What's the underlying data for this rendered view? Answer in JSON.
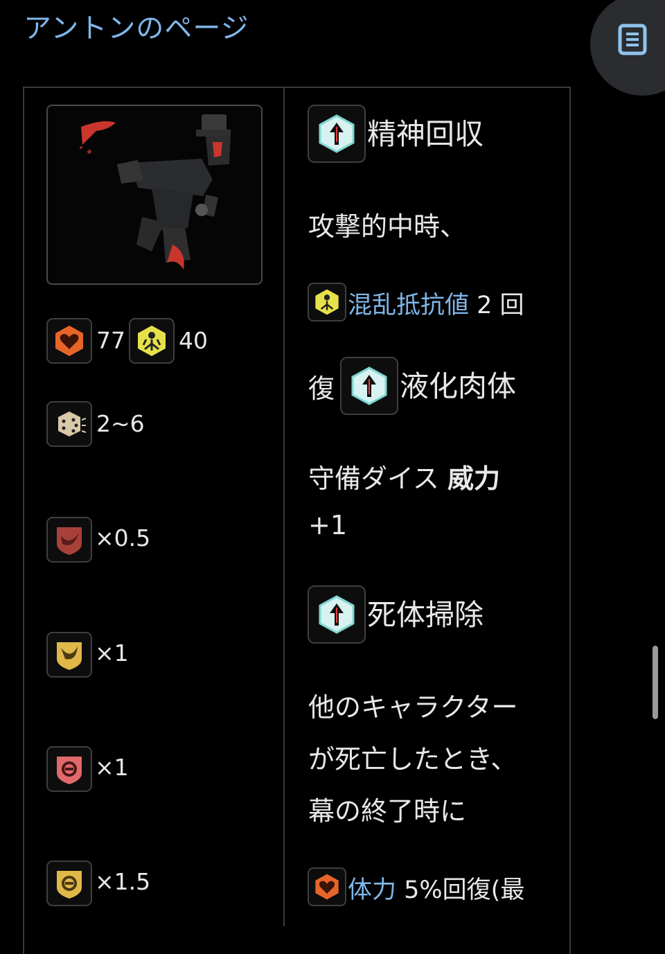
{
  "header": {
    "title": "アントンのページ"
  },
  "menu": {
    "icon": "list-document-icon"
  },
  "left": {
    "portrait_alt": "character-portrait",
    "stats": [
      {
        "icon": "health-heart-icon",
        "value": "77",
        "color": "#e8652a"
      },
      {
        "icon": "stress-resist-icon",
        "value": "40",
        "color": "#e6e14a"
      }
    ],
    "dice": {
      "icon": "dice-icon",
      "value": "2~6"
    },
    "resistances": [
      {
        "icon": "slash-resist-icon",
        "value": "×0.5",
        "color": "#a8413a"
      },
      {
        "icon": "pierce-resist-icon",
        "value": "×1",
        "color": "#e0b84a"
      },
      {
        "icon": "blunt-resist-icon",
        "value": "×1",
        "color": "#e06a6a"
      },
      {
        "icon": "stagger-resist-icon",
        "value": "×1.5",
        "color": "#e0b84a"
      }
    ]
  },
  "right": {
    "skill1": {
      "name": "精神回収",
      "icon": "passive-arrow-icon"
    },
    "line1": "攻撃的中時、",
    "line2_link": "混乱抵抗値",
    "line2_rest": " 2 回",
    "line3_prefix": "復",
    "skill2": {
      "name": "液化肉体",
      "icon": "passive-arrow-icon"
    },
    "line4_text": "守備ダイス ",
    "line4_bold": "威力",
    "line5": "+1",
    "skill3": {
      "name": "死体掃除",
      "icon": "passive-arrow-icon"
    },
    "line6": "他のキャラクター",
    "line7": "が死亡したとき、",
    "line8": "幕の終了時に",
    "line9_link": "体力",
    "line9_rest": " 5%回復(最"
  }
}
